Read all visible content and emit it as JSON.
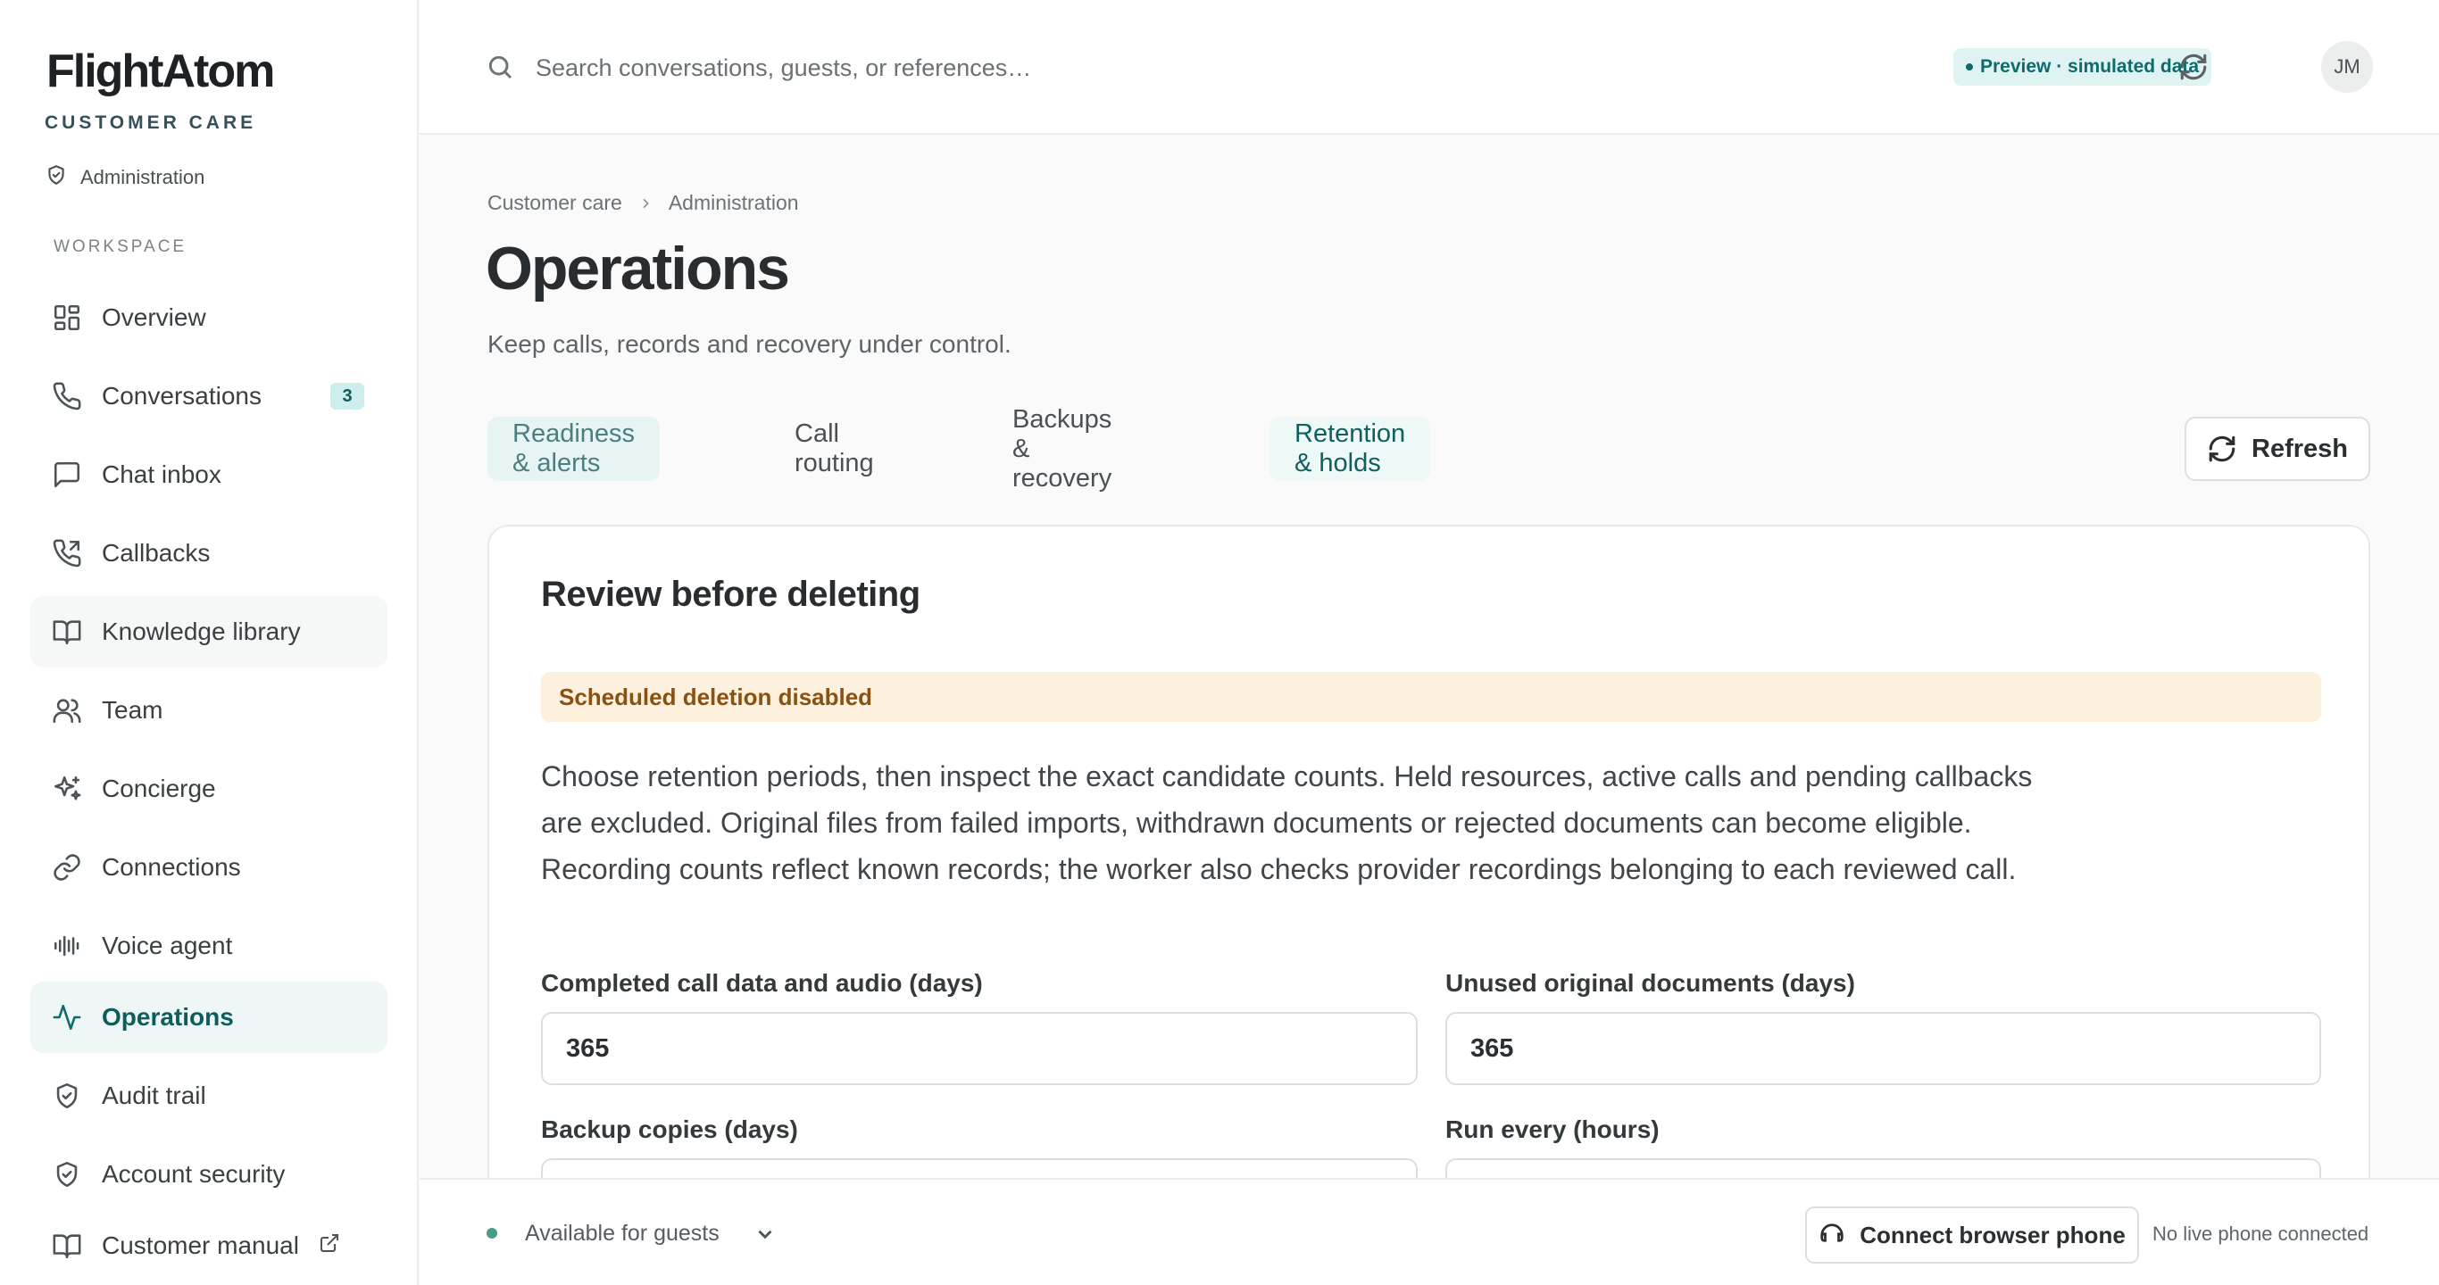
{
  "brand": {
    "logo": "FlightAtom",
    "subtitle": "CUSTOMER CARE",
    "admin_label": "Administration"
  },
  "sidebar": {
    "section_label": "WORKSPACE",
    "items": [
      {
        "label": "Overview",
        "icon": "grid-icon"
      },
      {
        "label": "Conversations",
        "icon": "phone-icon",
        "badge": "3"
      },
      {
        "label": "Chat inbox",
        "icon": "chat-icon"
      },
      {
        "label": "Callbacks",
        "icon": "phone-callback-icon"
      },
      {
        "label": "Knowledge library",
        "icon": "book-icon"
      },
      {
        "label": "Team",
        "icon": "users-icon"
      },
      {
        "label": "Concierge",
        "icon": "sparkles-icon"
      },
      {
        "label": "Connections",
        "icon": "link-icon"
      },
      {
        "label": "Voice agent",
        "icon": "waveform-icon"
      },
      {
        "label": "Operations",
        "icon": "activity-icon",
        "active": true
      },
      {
        "label": "Audit trail",
        "icon": "shield-icon"
      },
      {
        "label": "Account security",
        "icon": "shield-icon"
      },
      {
        "label": "Customer manual",
        "icon": "book-icon",
        "external": true
      }
    ]
  },
  "topbar": {
    "search_placeholder": "Search conversations, guests, or references…",
    "preview_chip": "Preview · simulated data",
    "avatar_initials": "JM"
  },
  "breadcrumb": [
    "Customer care",
    "Administration"
  ],
  "page": {
    "title": "Operations",
    "subtitle": "Keep calls, records and recovery under control."
  },
  "tabs": [
    {
      "label": "Readiness & alerts"
    },
    {
      "label": "Call routing"
    },
    {
      "label": "Backups & recovery"
    },
    {
      "label": "Retention & holds",
      "selected": true
    }
  ],
  "refresh_label": "Refresh",
  "card": {
    "title": "Review before deleting",
    "warning": "Scheduled deletion disabled",
    "description": "Choose retention periods, then inspect the exact candidate counts. Held resources, active calls and pending callbacks are excluded. Original files from failed imports, withdrawn documents or rejected documents can become eligible. Recording counts reflect known records; the worker also checks provider recordings belonging to each reviewed call.",
    "fields": {
      "call_data_label": "Completed call data and audio (days)",
      "call_data_value": "365",
      "documents_label": "Unused original documents (days)",
      "documents_value": "365",
      "backup_label": "Backup copies (days)",
      "run_every_label": "Run every (hours)"
    }
  },
  "bottombar": {
    "status": "Available for guests",
    "phone_button": "Connect browser phone",
    "phone_status": "No live phone connected"
  },
  "colors": {
    "accent": "#0f6b6b",
    "warning_bg": "#fdf0dc",
    "warning_text": "#8a5212"
  }
}
